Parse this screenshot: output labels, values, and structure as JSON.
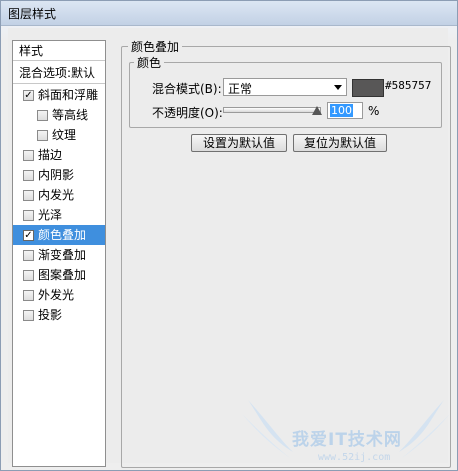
{
  "window": {
    "title": "图层样式"
  },
  "sidebar": {
    "header": "样式",
    "blend_options": "混合选项:默认",
    "items": [
      {
        "label": "斜面和浮雕",
        "checked": true
      },
      {
        "label": "等高线",
        "checked": false
      },
      {
        "label": "纹理",
        "checked": false
      },
      {
        "label": "描边",
        "checked": false
      },
      {
        "label": "内阴影",
        "checked": false
      },
      {
        "label": "内发光",
        "checked": false
      },
      {
        "label": "光泽",
        "checked": false
      },
      {
        "label": "颜色叠加",
        "checked": true,
        "selected": true
      },
      {
        "label": "渐变叠加",
        "checked": false
      },
      {
        "label": "图案叠加",
        "checked": false
      },
      {
        "label": "外发光",
        "checked": false
      },
      {
        "label": "投影",
        "checked": false
      }
    ]
  },
  "color_overlay": {
    "group_title": "颜色叠加",
    "sub_group_title": "颜色",
    "blend_mode_label": "混合模式(B):",
    "blend_mode_value": "正常",
    "color_hex": "#585757",
    "color_value": "#585757",
    "opacity_label": "不透明度(O):",
    "opacity_value": "100",
    "opacity_unit": "%",
    "opacity_fraction": 1.0,
    "set_default_label": "设置为默认值",
    "reset_default_label": "复位为默认值"
  },
  "watermark": {
    "text": "我爱IT技术网",
    "url": "www.52ij.com"
  },
  "colors": {
    "selection": "#3f8fde",
    "swatch": "#585757",
    "highlight": "#3399ff"
  }
}
